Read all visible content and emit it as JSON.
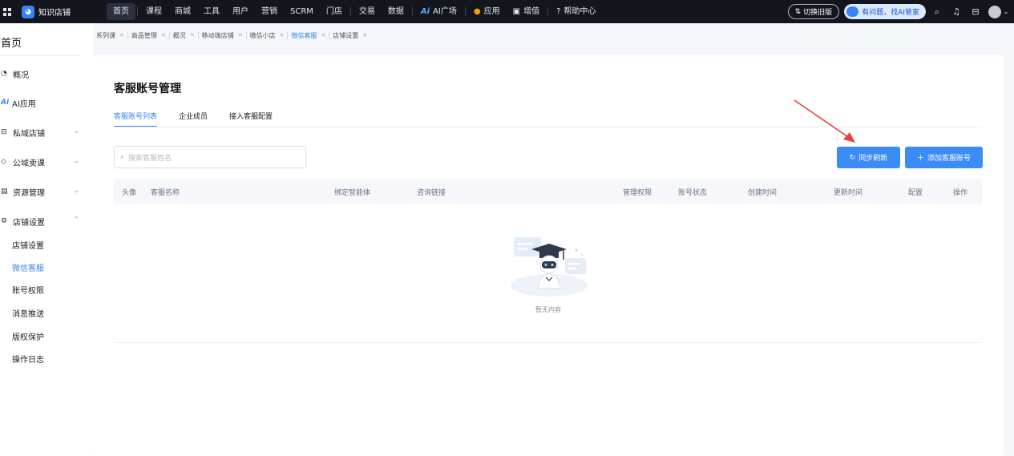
{
  "topbar": {
    "brand": "知识店铺",
    "nav": [
      "首页",
      "课程",
      "商城",
      "工具",
      "用户",
      "营销",
      "SCRM",
      "门店",
      "交易",
      "数据"
    ],
    "ai_plaza": "AI广场",
    "apps": "应用",
    "value_added": "增值",
    "help": "帮助中心",
    "switch_old": "切换旧版",
    "ai_helper": "有问题，找AI管家"
  },
  "sidebar": {
    "title": "首页",
    "items": [
      {
        "label": "概况",
        "icon": "pie-chart-icon"
      },
      {
        "label": "AI应用",
        "icon": "ai-icon"
      },
      {
        "label": "私域店铺",
        "icon": "store-icon"
      },
      {
        "label": "公域卖课",
        "icon": "globe-icon"
      },
      {
        "label": "资源管理",
        "icon": "folder-icon"
      },
      {
        "label": "店铺设置",
        "icon": "gear-icon"
      }
    ],
    "sub_items": [
      "店铺设置",
      "微信客服",
      "账号权限",
      "消息推送",
      "版权保护",
      "操作日志"
    ]
  },
  "tabs": [
    "系列课",
    "商品管理",
    "概况",
    "移动端店铺",
    "微信小店",
    "微信客服",
    "店铺设置"
  ],
  "main": {
    "title": "客服账号管理",
    "subtabs": [
      "客服账号列表",
      "企业成员",
      "接入客服配置"
    ],
    "search_placeholder": "搜索客服姓名",
    "sync_button": "同步刷新",
    "add_button": "添加客服账号",
    "columns": [
      "头像",
      "客服名称",
      "绑定智能体",
      "咨询链接",
      "管理权限",
      "账号状态",
      "创建时间",
      "更新时间",
      "配置",
      "操作"
    ],
    "empty_text": "暂无内容"
  },
  "colors": {
    "accent": "#3b82f6",
    "topbar": "#13161d",
    "annotation_arrow": "#e8423a"
  }
}
